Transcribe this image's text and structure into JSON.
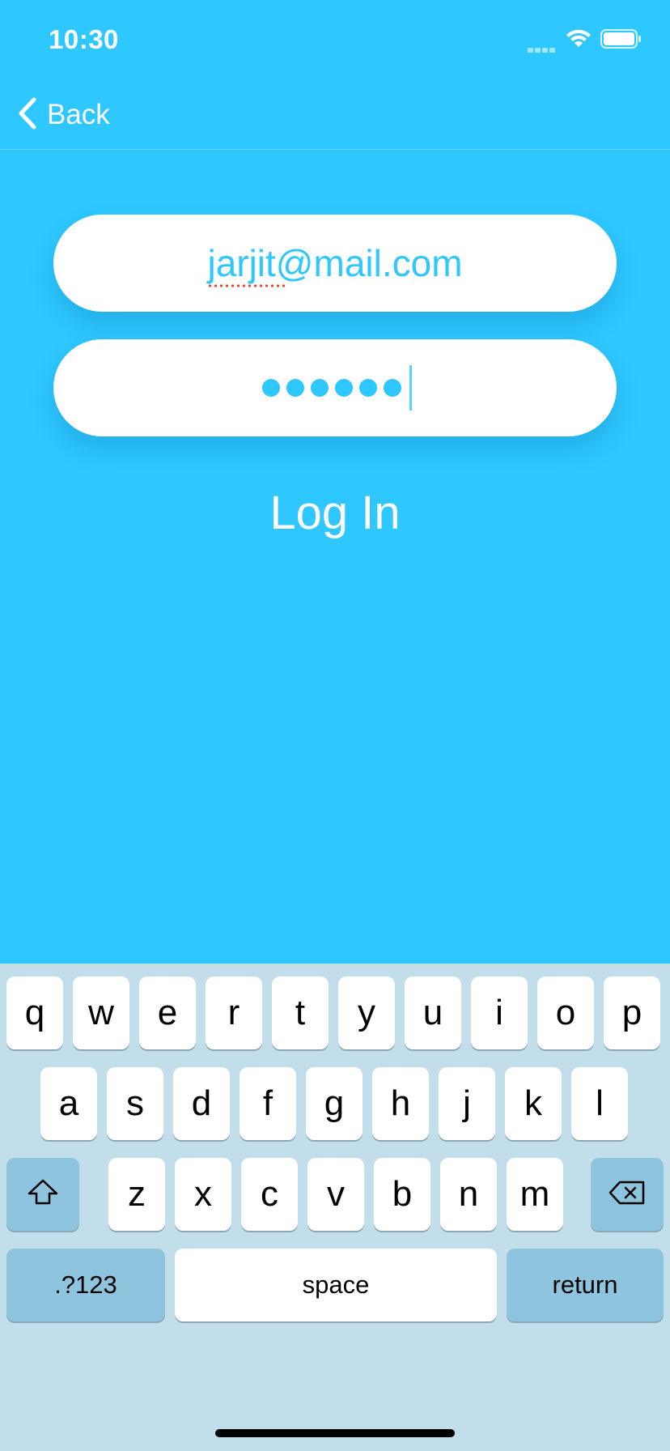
{
  "status_bar": {
    "time": "10:30"
  },
  "nav": {
    "back_label": "Back"
  },
  "form": {
    "email_value": "jarjit@mail.com",
    "password_mask": [
      "●",
      "●",
      "●",
      "●",
      "●",
      "●"
    ],
    "login_label": "Log In"
  },
  "keyboard": {
    "row1": [
      "q",
      "w",
      "e",
      "r",
      "t",
      "y",
      "u",
      "i",
      "o",
      "p"
    ],
    "row2": [
      "a",
      "s",
      "d",
      "f",
      "g",
      "h",
      "j",
      "k",
      "l"
    ],
    "row3": [
      "z",
      "x",
      "c",
      "v",
      "b",
      "n",
      "m"
    ],
    "numbers_label": ".?123",
    "space_label": "space",
    "return_label": "return"
  },
  "colors": {
    "background": "#2EC7FF",
    "accent_text": "#2EC7FF",
    "keyboard_bg": "#C2DEEB",
    "dark_key": "#8EC4DD"
  }
}
